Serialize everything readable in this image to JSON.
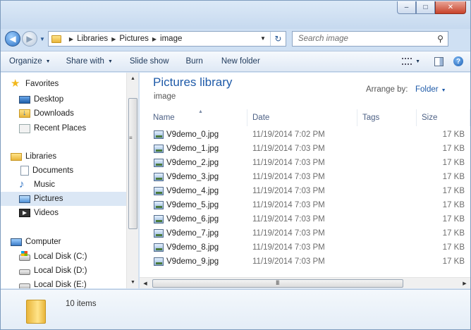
{
  "window": {
    "minimize_glyph": "–",
    "maximize_glyph": "□",
    "close_glyph": "✕"
  },
  "navbar": {
    "breadcrumbs": [
      "Libraries",
      "Pictures",
      "image"
    ],
    "search_placeholder": "Search image",
    "refresh_glyph": "↻",
    "search_glyph": "⚲"
  },
  "toolbar": {
    "organize": "Organize",
    "share_with": "Share with",
    "slide_show": "Slide show",
    "burn": "Burn",
    "new_folder": "New folder",
    "help_glyph": "?"
  },
  "sidebar": {
    "favorites": "Favorites",
    "desktop": "Desktop",
    "downloads": "Downloads",
    "recent_places": "Recent Places",
    "libraries": "Libraries",
    "documents": "Documents",
    "music": "Music",
    "pictures": "Pictures",
    "videos": "Videos",
    "computer": "Computer",
    "disk_c": "Local Disk (C:)",
    "disk_d": "Local Disk (D:)",
    "disk_e": "Local Disk (E:)",
    "selected": "Pictures"
  },
  "library": {
    "title": "Pictures library",
    "subtitle": "image",
    "arrange_label": "Arrange by:",
    "arrange_value": "Folder"
  },
  "columns": {
    "name": "Name",
    "date": "Date",
    "tags": "Tags",
    "size": "Size"
  },
  "files": [
    {
      "name": "V9demo_0.jpg",
      "date": "11/19/2014 7:02 PM",
      "size": "17 KB"
    },
    {
      "name": "V9demo_1.jpg",
      "date": "11/19/2014 7:03 PM",
      "size": "17 KB"
    },
    {
      "name": "V9demo_2.jpg",
      "date": "11/19/2014 7:03 PM",
      "size": "17 KB"
    },
    {
      "name": "V9demo_3.jpg",
      "date": "11/19/2014 7:03 PM",
      "size": "17 KB"
    },
    {
      "name": "V9demo_4.jpg",
      "date": "11/19/2014 7:03 PM",
      "size": "17 KB"
    },
    {
      "name": "V9demo_5.jpg",
      "date": "11/19/2014 7:03 PM",
      "size": "17 KB"
    },
    {
      "name": "V9demo_6.jpg",
      "date": "11/19/2014 7:03 PM",
      "size": "17 KB"
    },
    {
      "name": "V9demo_7.jpg",
      "date": "11/19/2014 7:03 PM",
      "size": "17 KB"
    },
    {
      "name": "V9demo_8.jpg",
      "date": "11/19/2014 7:03 PM",
      "size": "17 KB"
    },
    {
      "name": "V9demo_9.jpg",
      "date": "11/19/2014 7:03 PM",
      "size": "17 KB"
    }
  ],
  "details": {
    "items_count": "10 items"
  },
  "scroll": {
    "h_grip": "III"
  }
}
